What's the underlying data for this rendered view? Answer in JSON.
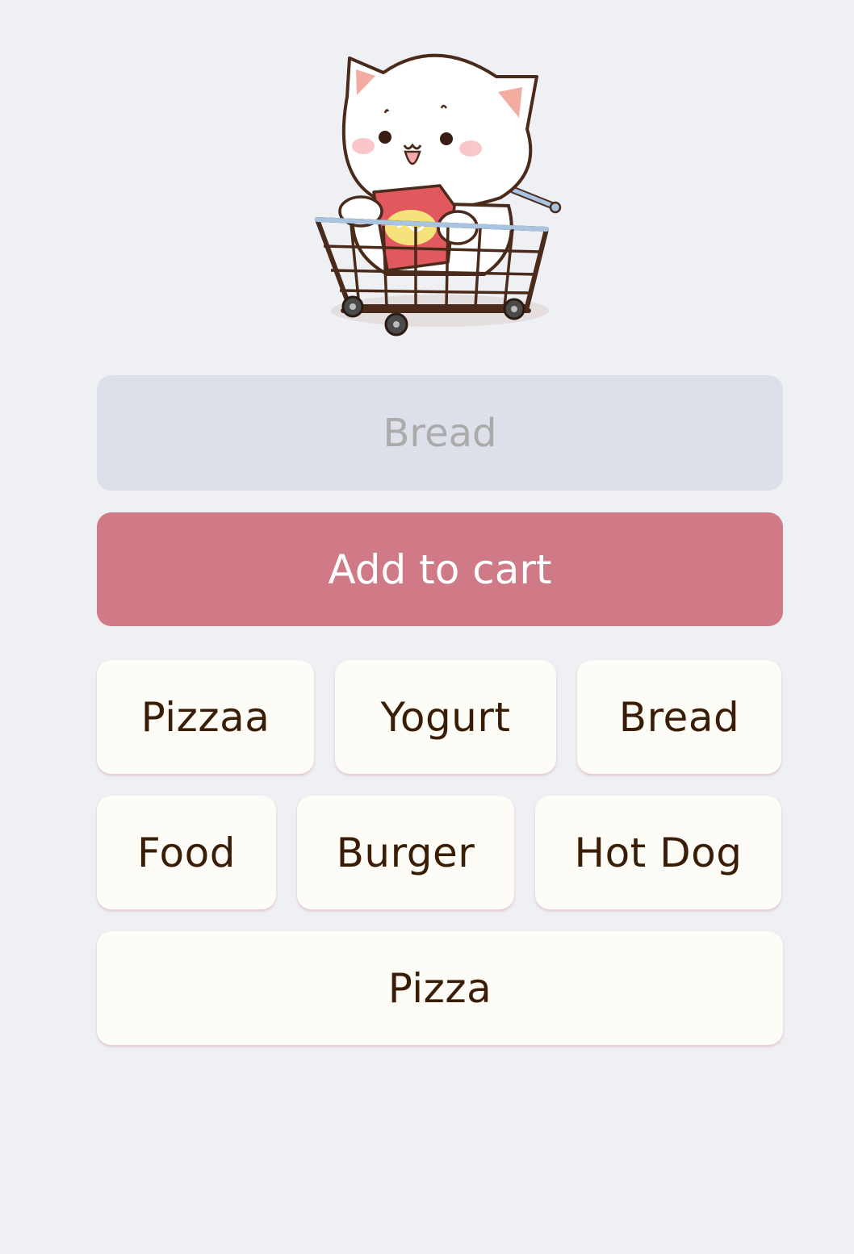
{
  "input": {
    "value": "",
    "placeholder": "Bread"
  },
  "add_button": {
    "label": "Add to cart"
  },
  "items": [
    [
      "Pizzaa",
      "Yogurt",
      "Bread"
    ],
    [
      "Food",
      "Burger",
      "Hot Dog"
    ],
    [
      "Pizza"
    ]
  ],
  "colors": {
    "background": "#eef0f4",
    "input_background": "#dde0e8",
    "button_accent": "#d07a88",
    "item_background": "#fefcf6",
    "item_text": "#3a1d06"
  },
  "icons": {
    "hero": "cat-in-shopping-cart-icon"
  }
}
